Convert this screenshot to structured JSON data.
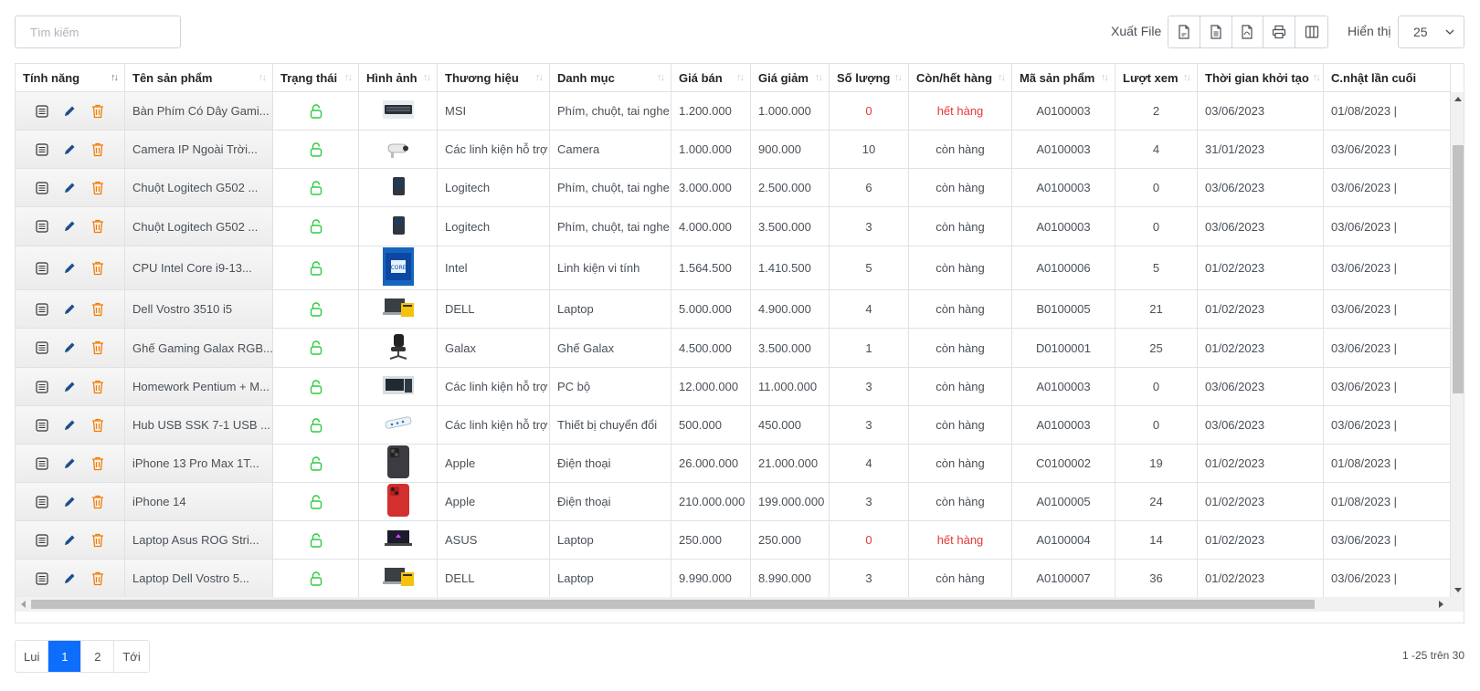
{
  "search": {
    "placeholder": "Tìm kiếm"
  },
  "toolbar": {
    "export_label": "Xuất File",
    "export_buttons": [
      "csv-file-icon",
      "excel-file-icon",
      "pdf-file-icon",
      "print-icon",
      "columns-icon"
    ],
    "show_label": "Hiển thị",
    "page_size": "25"
  },
  "columns": [
    "Tính năng",
    "Tên sản phẩm",
    "Trạng thái",
    "Hình ảnh",
    "Thương hiệu",
    "Danh mục",
    "Giá bán",
    "Giá giảm",
    "Số lượng",
    "Còn/hết hàng",
    "Mã sản phẩm",
    "Lượt xem",
    "Thời gian khởi tạo",
    "C.nhật lần cuối"
  ],
  "rows": [
    {
      "name": "Bàn Phím Có Dây Gami...",
      "image": "keyboard",
      "brand": "MSI",
      "category": "Phím, chuột, tai nghe",
      "price": "1.200.000",
      "sale": "1.000.000",
      "qty": "0",
      "stock": "hết hàng",
      "code": "A0100003",
      "views": "2",
      "created": "03/06/2023",
      "updated": "01/08/2023 |"
    },
    {
      "name": "Camera IP Ngoài Trời...",
      "image": "camera",
      "brand": "Các linh kiện hỗ trợ",
      "category": "Camera",
      "price": "1.000.000",
      "sale": "900.000",
      "qty": "10",
      "stock": "còn hàng",
      "code": "A0100003",
      "views": "4",
      "created": "31/01/2023",
      "updated": "03/06/2023 |"
    },
    {
      "name": "Chuột Logitech G502 ...",
      "image": "mouse",
      "brand": "Logitech",
      "category": "Phím, chuột, tai nghe",
      "price": "3.000.000",
      "sale": "2.500.000",
      "qty": "6",
      "stock": "còn hàng",
      "code": "A0100003",
      "views": "0",
      "created": "03/06/2023",
      "updated": "03/06/2023 |"
    },
    {
      "name": "Chuột Logitech G502 ...",
      "image": "mouse",
      "brand": "Logitech",
      "category": "Phím, chuột, tai nghe",
      "price": "4.000.000",
      "sale": "3.500.000",
      "qty": "3",
      "stock": "còn hàng",
      "code": "A0100003",
      "views": "0",
      "created": "03/06/2023",
      "updated": "03/06/2023 |"
    },
    {
      "name": "CPU Intel Core i9-13...",
      "image": "cpu",
      "brand": "Intel",
      "category": "Linh kiện vi tính",
      "price": "1.564.500",
      "sale": "1.410.500",
      "qty": "5",
      "stock": "còn hàng",
      "code": "A0100006",
      "views": "5",
      "created": "01/02/2023",
      "updated": "03/06/2023 |"
    },
    {
      "name": "Dell Vostro 3510 i5",
      "image": "laptop-yellow",
      "brand": "DELL",
      "category": "Laptop",
      "price": "5.000.000",
      "sale": "4.900.000",
      "qty": "4",
      "stock": "còn hàng",
      "code": "B0100005",
      "views": "21",
      "created": "01/02/2023",
      "updated": "03/06/2023 |"
    },
    {
      "name": "Ghế Gaming Galax RGB...",
      "image": "chair",
      "brand": "Galax",
      "category": "Ghế Galax",
      "price": "4.500.000",
      "sale": "3.500.000",
      "qty": "1",
      "stock": "còn hàng",
      "code": "D0100001",
      "views": "25",
      "created": "01/02/2023",
      "updated": "03/06/2023 |"
    },
    {
      "name": "Homework Pentium + M...",
      "image": "pc",
      "brand": "Các linh kiện hỗ trợ",
      "category": "PC bộ",
      "price": "12.000.000",
      "sale": "11.000.000",
      "qty": "3",
      "stock": "còn hàng",
      "code": "A0100003",
      "views": "0",
      "created": "03/06/2023",
      "updated": "03/06/2023 |"
    },
    {
      "name": "Hub USB SSK 7-1 USB ...",
      "image": "hub",
      "brand": "Các linh kiện hỗ trợ",
      "category": "Thiết bị chuyển đổi",
      "price": "500.000",
      "sale": "450.000",
      "qty": "3",
      "stock": "còn hàng",
      "code": "A0100003",
      "views": "0",
      "created": "03/06/2023",
      "updated": "03/06/2023 |"
    },
    {
      "name": "iPhone 13 Pro Max 1T...",
      "image": "iphone-dark",
      "brand": "Apple",
      "category": "Điện thoại",
      "price": "26.000.000",
      "sale": "21.000.000",
      "qty": "4",
      "stock": "còn hàng",
      "code": "C0100002",
      "views": "19",
      "created": "01/02/2023",
      "updated": "01/08/2023 |"
    },
    {
      "name": "iPhone 14",
      "image": "iphone-red",
      "brand": "Apple",
      "category": "Điện thoại",
      "price": "210.000.000",
      "sale": "199.000.000",
      "qty": "3",
      "stock": "còn hàng",
      "code": "A0100005",
      "views": "24",
      "created": "01/02/2023",
      "updated": "01/08/2023 |"
    },
    {
      "name": "Laptop Asus ROG Stri...",
      "image": "laptop-rog",
      "brand": "ASUS",
      "category": "Laptop",
      "price": "250.000",
      "sale": "250.000",
      "qty": "0",
      "stock": "hết hàng",
      "code": "A0100004",
      "views": "14",
      "created": "01/02/2023",
      "updated": "03/06/2023 |"
    },
    {
      "name": "Laptop Dell Vostro 5...",
      "image": "laptop-yellow",
      "brand": "DELL",
      "category": "Laptop",
      "price": "9.990.000",
      "sale": "8.990.000",
      "qty": "3",
      "stock": "còn hàng",
      "code": "A0100007",
      "views": "36",
      "created": "01/02/2023",
      "updated": "03/06/2023 |"
    }
  ],
  "colors": {
    "accent": "#0d6efd",
    "unlock": "#2ecc40",
    "out_of_stock": "#e53935",
    "edit": "#1f4e8c",
    "delete": "#f57c00"
  },
  "pagination": {
    "prev": "Lui",
    "pages": [
      "1",
      "2"
    ],
    "active": "1",
    "next": "Tới",
    "range": "1 -25 trên 30"
  }
}
